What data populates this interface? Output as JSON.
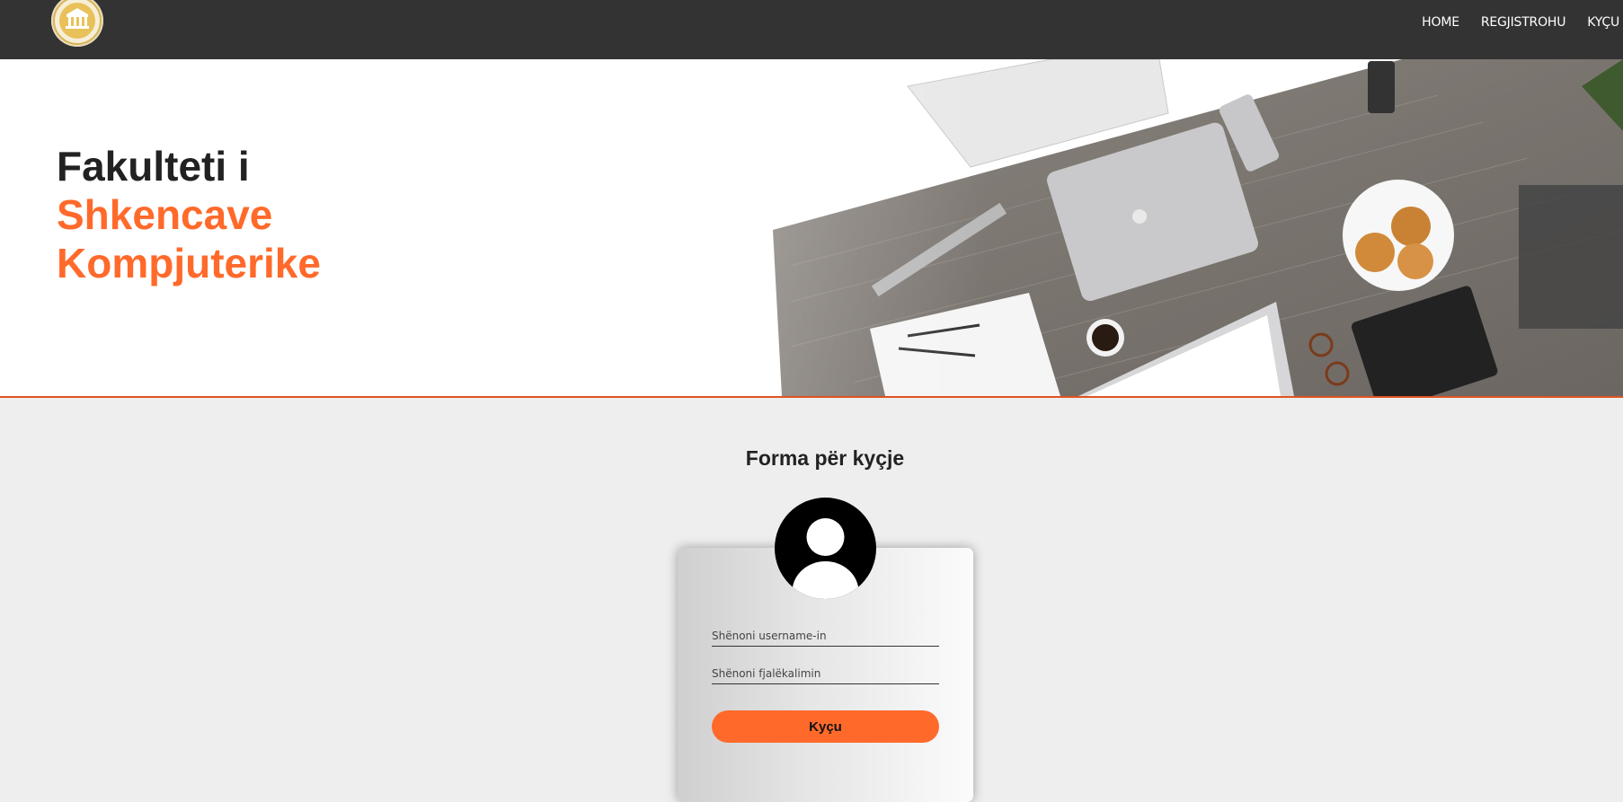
{
  "nav": {
    "links": [
      "HOME",
      "REGJISTROHU",
      "KYÇU"
    ],
    "background": "#333333"
  },
  "hero": {
    "title_line1": "Fakulteti i",
    "title_line2": "Shkencave",
    "title_line3": "Kompjuterike",
    "accent_color": "#ff6a2b"
  },
  "login": {
    "heading": "Forma për kyçje",
    "username_placeholder": "Shënoni username-in",
    "password_placeholder": "Shënoni fjalëkalimin",
    "submit_label": "Kyçu"
  }
}
